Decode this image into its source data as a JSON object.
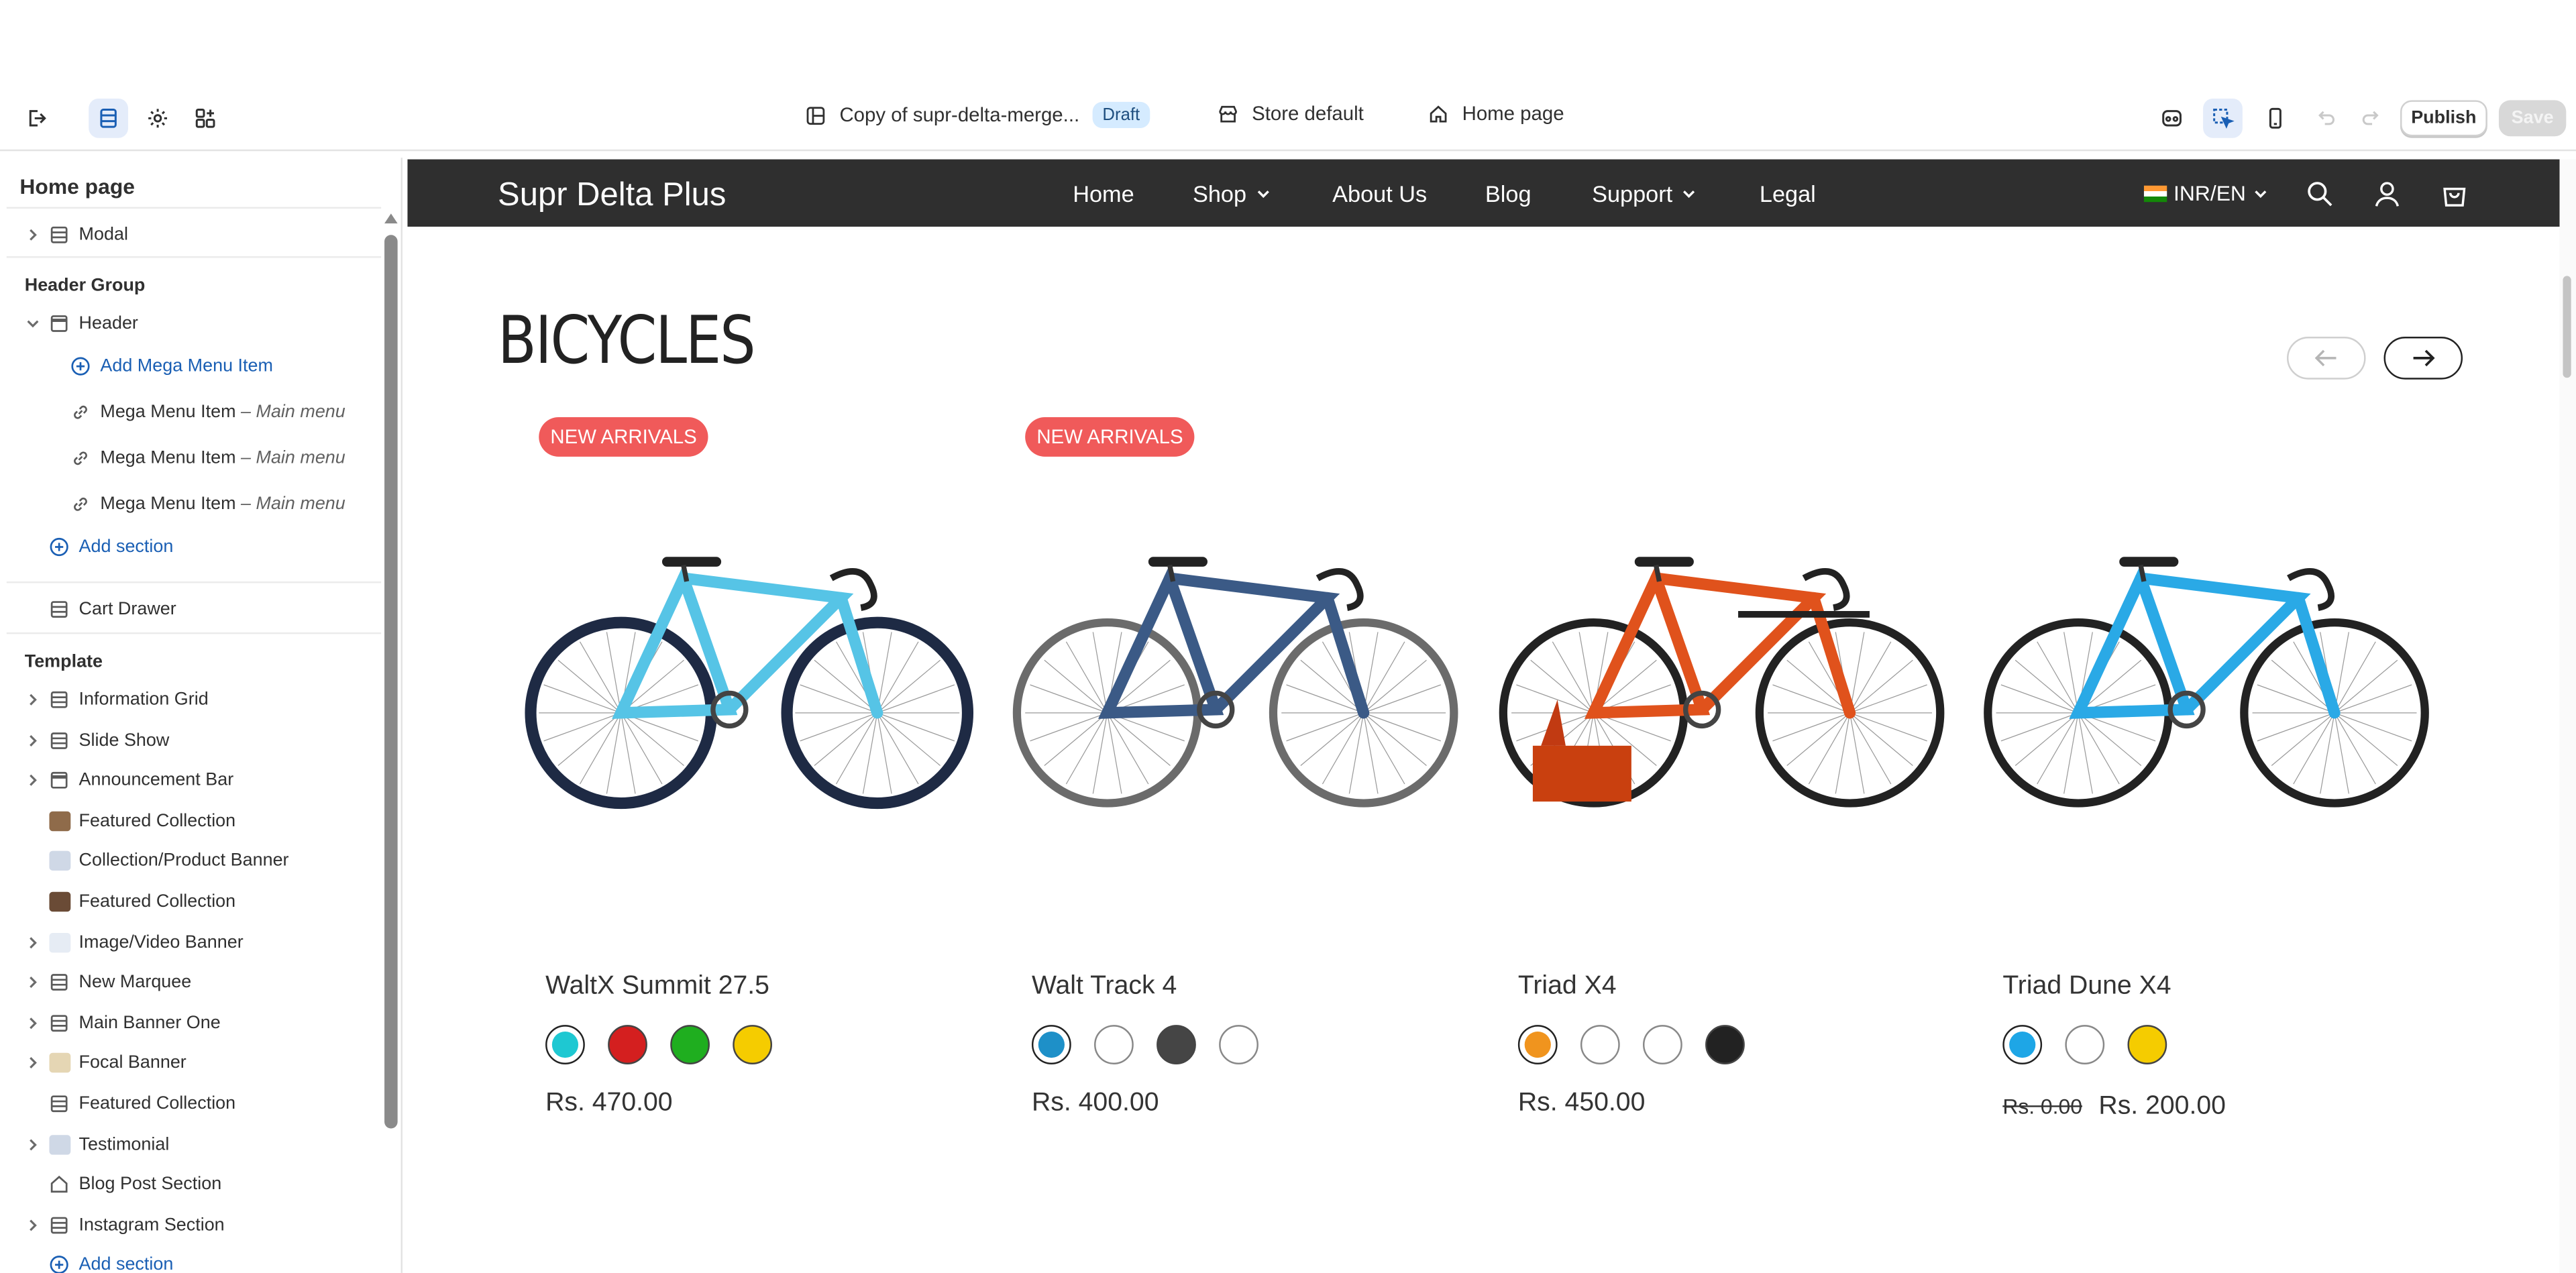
{
  "toolbar": {
    "theme_name": "Copy of supr-delta-merge...",
    "theme_status": "Draft",
    "market": "Store default",
    "template": "Home page",
    "publish_label": "Publish",
    "save_label": "Save"
  },
  "sidebar": {
    "title": "Home page",
    "top_items": [
      {
        "label": "Modal",
        "icon": "section-icon",
        "expandable": true
      }
    ],
    "header_group": {
      "title": "Header Group",
      "header_label": "Header",
      "add_mega_menu": "Add Mega Menu Item",
      "mega_items": [
        {
          "label": "Mega Menu Item",
          "suffix": "– Main menu"
        },
        {
          "label": "Mega Menu Item",
          "suffix": "– Main menu"
        },
        {
          "label": "Mega Menu Item",
          "suffix": "– Main menu"
        }
      ],
      "add_section": "Add section",
      "cart_drawer": "Cart Drawer"
    },
    "template": {
      "title": "Template",
      "items": [
        {
          "label": "Information Grid",
          "icon": "section-icon",
          "expandable": true
        },
        {
          "label": "Slide Show",
          "icon": "section-icon",
          "expandable": true
        },
        {
          "label": "Announcement Bar",
          "icon": "header-icon",
          "expandable": true
        },
        {
          "label": "Featured Collection",
          "icon": "thumb",
          "expandable": false
        },
        {
          "label": "Collection/Product Banner",
          "icon": "thumb",
          "expandable": false
        },
        {
          "label": "Featured Collection",
          "icon": "thumb",
          "expandable": false
        },
        {
          "label": "Image/Video Banner",
          "icon": "thumb",
          "expandable": true
        },
        {
          "label": "New Marquee",
          "icon": "section-icon",
          "expandable": true
        },
        {
          "label": "Main Banner One",
          "icon": "section-icon",
          "expandable": true
        },
        {
          "label": "Focal Banner",
          "icon": "thumb",
          "expandable": true
        },
        {
          "label": "Featured Collection",
          "icon": "section-icon",
          "expandable": false
        },
        {
          "label": "Testimonial",
          "icon": "thumb",
          "expandable": true
        },
        {
          "label": "Blog Post Section",
          "icon": "home-icon",
          "expandable": false
        },
        {
          "label": "Instagram Section",
          "icon": "section-icon",
          "expandable": true
        }
      ],
      "add_section": "Add section"
    }
  },
  "store": {
    "logo": "Supr Delta Plus",
    "nav": [
      {
        "label": "Home",
        "dropdown": false
      },
      {
        "label": "Shop",
        "dropdown": true
      },
      {
        "label": "About Us",
        "dropdown": false
      },
      {
        "label": "Blog",
        "dropdown": false
      },
      {
        "label": "Support",
        "dropdown": true
      },
      {
        "label": "Legal",
        "dropdown": false
      }
    ],
    "locale": "INR/EN",
    "section_title": "BICYCLES",
    "products": [
      {
        "name": "WaltX Summit 27.5",
        "badge": "NEW ARRIVALS",
        "price": "Rs. 470.00",
        "old_price": "",
        "frame_color": "#56c4e6",
        "swatches": [
          "#1ec8d2",
          "#d41f1f",
          "#1fae1f",
          "#f5cc00"
        ]
      },
      {
        "name": "Walt Track 4",
        "badge": "NEW ARRIVALS",
        "price": "Rs. 400.00",
        "old_price": "",
        "frame_color": "#3b5a86",
        "swatches": [
          "#1e90c8",
          "#ffffff",
          "#454545",
          "#ffffff"
        ]
      },
      {
        "name": "Triad X4",
        "badge": "",
        "price": "Rs. 450.00",
        "old_price": "",
        "frame_color": "#e0521c",
        "swatches": [
          "#f0941e",
          "#ffffff",
          "#ffffff",
          "#222222"
        ]
      },
      {
        "name": "Triad Dune X4",
        "badge": "",
        "price": "Rs. 200.00",
        "old_price": "Rs. 0.00",
        "frame_color": "#2aa9e6",
        "swatches": [
          "#1ea6e6",
          "#ffffff",
          "#f5cc00"
        ]
      }
    ]
  }
}
